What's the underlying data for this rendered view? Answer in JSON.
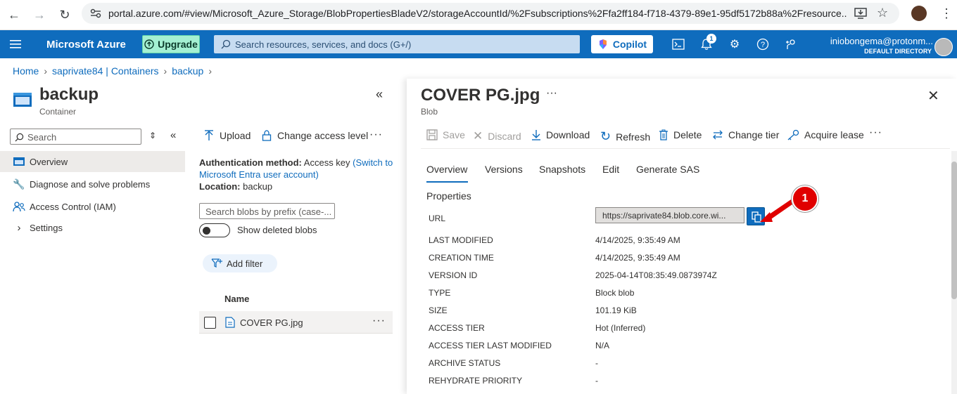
{
  "browser": {
    "url": "portal.azure.com/#view/Microsoft_Azure_Storage/BlobPropertiesBladeV2/storageAccountId/%2Fsubscriptions%2Ffa2ff184-f718-4379-89e1-95df5172b88a%2Fresource..."
  },
  "azure_header": {
    "brand": "Microsoft Azure",
    "upgrade_label": "Upgrade",
    "search_placeholder": "Search resources, services, and docs (G+/)",
    "copilot_label": "Copilot",
    "notification_count": "1",
    "user_name": "iniobongema@protonm...",
    "user_directory": "DEFAULT DIRECTORY"
  },
  "breadcrumb": {
    "items": [
      "Home",
      "saprivate84 | Containers",
      "backup"
    ]
  },
  "left_blade": {
    "title": "backup",
    "subtitle": "Container",
    "search_placeholder": "Search",
    "menu": [
      {
        "label": "Overview",
        "icon": "overview-icon"
      },
      {
        "label": "Diagnose and solve problems",
        "icon": "wrench-icon"
      },
      {
        "label": "Access Control (IAM)",
        "icon": "people-icon"
      },
      {
        "label": "Settings",
        "icon": "chevron-right-icon"
      }
    ]
  },
  "middle": {
    "toolbar": {
      "upload": "Upload",
      "change_access": "Change access level"
    },
    "auth_label": "Authentication method:",
    "auth_value": "Access key",
    "auth_link": "(Switch to Microsoft Entra user account)",
    "location_label": "Location:",
    "location_value": "backup",
    "blob_search_placeholder": "Search blobs by prefix (case-...",
    "show_deleted_label": "Show deleted blobs",
    "add_filter_label": "Add filter",
    "column_name": "Name",
    "blobs": [
      {
        "name": "COVER PG.jpg"
      }
    ]
  },
  "right_blade": {
    "title": "COVER PG.jpg",
    "subtitle": "Blob",
    "commands": {
      "save": "Save",
      "discard": "Discard",
      "download": "Download",
      "refresh": "Refresh",
      "delete": "Delete",
      "change_tier": "Change tier",
      "acquire_lease": "Acquire lease"
    },
    "tabs": [
      "Overview",
      "Versions",
      "Snapshots",
      "Edit",
      "Generate SAS"
    ],
    "active_tab": "Overview",
    "properties_heading": "Properties",
    "url_label": "URL",
    "url_value": "https://saprivate84.blob.core.wi...",
    "properties": [
      {
        "key": "LAST MODIFIED",
        "value": "4/14/2025, 9:35:49 AM"
      },
      {
        "key": "CREATION TIME",
        "value": "4/14/2025, 9:35:49 AM"
      },
      {
        "key": "VERSION ID",
        "value": "2025-04-14T08:35:49.0873974Z"
      },
      {
        "key": "TYPE",
        "value": "Block blob"
      },
      {
        "key": "SIZE",
        "value": "101.19 KiB"
      },
      {
        "key": "ACCESS TIER",
        "value": "Hot (Inferred)"
      },
      {
        "key": "ACCESS TIER LAST MODIFIED",
        "value": "N/A"
      },
      {
        "key": "ARCHIVE STATUS",
        "value": "-"
      },
      {
        "key": "REHYDRATE PRIORITY",
        "value": "-"
      }
    ]
  },
  "annotation": {
    "step_number": "1",
    "color": "#e00000"
  }
}
